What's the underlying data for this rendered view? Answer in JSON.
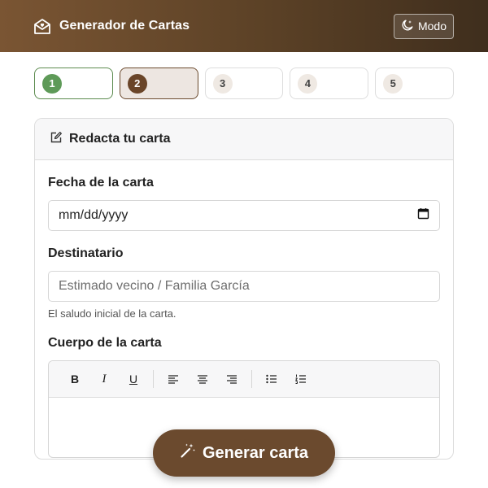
{
  "header": {
    "title": "Generador de Cartas",
    "mode_label": "Modo",
    "brand_icon": "envelope-heart-icon",
    "mode_icon": "moon-stars-icon"
  },
  "steps": [
    {
      "number": "1",
      "state": "done"
    },
    {
      "number": "2",
      "state": "active"
    },
    {
      "number": "3",
      "state": "pending"
    },
    {
      "number": "4",
      "state": "pending"
    },
    {
      "number": "5",
      "state": "pending"
    }
  ],
  "card": {
    "title": "Redacta tu carta",
    "title_icon": "pencil-square-icon"
  },
  "form": {
    "date_label": "Fecha de la carta",
    "date_value": "mm/dd/yyyy",
    "recipient_label": "Destinatario",
    "recipient_placeholder": "Estimado vecino / Familia García",
    "recipient_help": "El saludo inicial de la carta.",
    "body_label": "Cuerpo de la carta"
  },
  "toolbar": {
    "bold": "B",
    "italic": "I",
    "underline": "U"
  },
  "actions": {
    "generate_label": "Generar carta",
    "generate_icon": "magic-wand-icon"
  },
  "colors": {
    "header_start": "#7a5533",
    "header_end": "#3f2e1d",
    "accent": "#6b4a2e",
    "success": "#5e9a58"
  }
}
